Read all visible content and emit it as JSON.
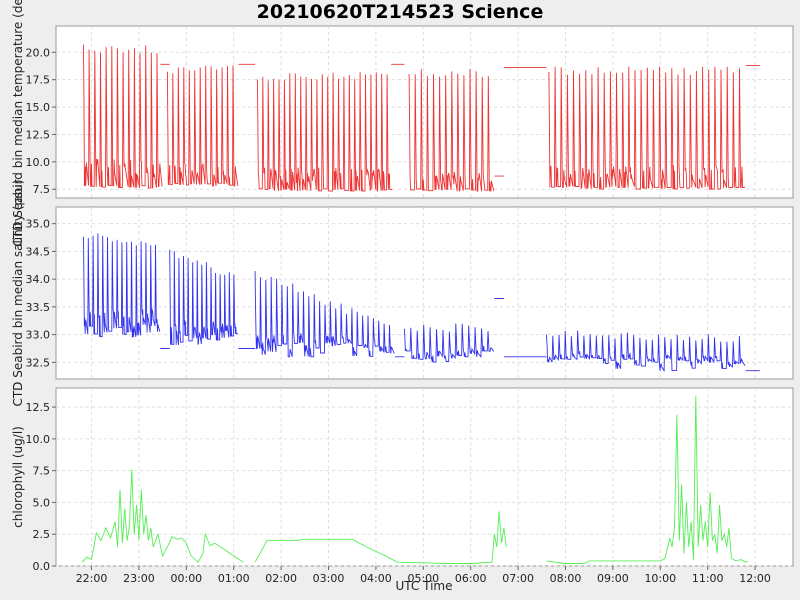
{
  "chart_data": {
    "title": "20210620T214523 Science",
    "xlabel": "UTC Time",
    "x_ticks": [
      "22:00",
      "23:00",
      "00:00",
      "01:00",
      "02:00",
      "03:00",
      "04:00",
      "05:00",
      "06:00",
      "07:00",
      "08:00",
      "09:00",
      "10:00",
      "11:00",
      "12:00"
    ],
    "x_range_hours": [
      21.25,
      24.8
    ],
    "grid": true,
    "panels": [
      {
        "type": "line",
        "ylabel": "CTD Seabird bin median temperature (degC)",
        "ylim": [
          6.7,
          22.4
        ],
        "y_ticks": [
          7.5,
          10.0,
          12.5,
          15.0,
          17.5,
          20.0
        ],
        "y_tick_labels": [
          "7.5",
          "10.0",
          "12.5",
          "15.0",
          "17.5",
          "20.0"
        ],
        "color": "#ee3333",
        "segments": [
          {
            "start": 21.83,
            "end": 23.5,
            "casts": 14,
            "high": 20.7,
            "low": 7.6,
            "mid": 9.5
          },
          {
            "start": 23.6,
            "end": 25.1,
            "casts": 13,
            "high": 18.8,
            "low": 7.8,
            "mid": 9.2
          },
          {
            "start": 25.5,
            "end": 28.35,
            "casts": 25,
            "high": 18.2,
            "low": 7.3,
            "mid": 8.8
          },
          {
            "start": 28.7,
            "end": 30.5,
            "casts": 14,
            "high": 18.5,
            "low": 7.3,
            "mid": 8.5
          },
          {
            "start": 31.65,
            "end": 35.8,
            "casts": 32,
            "high": 18.7,
            "low": 7.5,
            "mid": 9.0
          }
        ],
        "flats": [
          {
            "start": 23.45,
            "end": 23.65,
            "value": 18.9
          },
          {
            "start": 25.1,
            "end": 25.45,
            "value": 18.9
          },
          {
            "start": 28.32,
            "end": 28.6,
            "value": 18.9
          },
          {
            "start": 30.5,
            "end": 30.7,
            "value": 8.7
          },
          {
            "start": 30.7,
            "end": 31.6,
            "value": 18.6
          },
          {
            "start": 35.8,
            "end": 36.1,
            "value": 18.8
          }
        ]
      },
      {
        "type": "line",
        "ylabel": "CTD Seabird bin median salinity (psu)",
        "ylim": [
          32.2,
          35.3
        ],
        "y_ticks": [
          32.5,
          33.0,
          33.5,
          34.0,
          34.5,
          35.0
        ],
        "y_tick_labels": [
          "32.5",
          "33.0",
          "33.5",
          "34.0",
          "34.5",
          "35.0"
        ],
        "color": "#3333ee",
        "segments": [
          {
            "start": 21.83,
            "end": 23.45,
            "casts": 16,
            "high_start": 34.9,
            "high_end": 34.7,
            "low": 32.95
          },
          {
            "start": 23.65,
            "end": 25.1,
            "casts": 15,
            "high_start": 34.6,
            "high_end": 34.1,
            "low": 32.8
          },
          {
            "start": 25.45,
            "end": 28.4,
            "casts": 26,
            "high_start": 34.2,
            "high_end": 33.2,
            "low": 32.6
          },
          {
            "start": 28.6,
            "end": 30.5,
            "casts": 14,
            "high_start": 33.2,
            "high_end": 33.2,
            "low": 32.5
          },
          {
            "start": 31.6,
            "end": 35.8,
            "casts": 32,
            "high_start": 33.1,
            "high_end": 33.0,
            "low": 32.35
          }
        ],
        "flats": [
          {
            "start": 23.45,
            "end": 23.65,
            "value": 32.75
          },
          {
            "start": 25.1,
            "end": 25.45,
            "value": 32.75
          },
          {
            "start": 28.4,
            "end": 28.6,
            "value": 32.6
          },
          {
            "start": 30.5,
            "end": 30.7,
            "value": 33.65
          },
          {
            "start": 30.7,
            "end": 31.6,
            "value": 32.6
          },
          {
            "start": 35.8,
            "end": 36.1,
            "value": 32.35
          }
        ]
      },
      {
        "type": "line",
        "ylabel": "chlorophyll (ug/l)",
        "ylim": [
          0.0,
          14.0
        ],
        "y_ticks": [
          0.0,
          2.5,
          5.0,
          7.5,
          10.0,
          12.5
        ],
        "y_tick_labels": [
          "0.0",
          "2.5",
          "5.0",
          "7.5",
          "10.0",
          "12.5"
        ],
        "color": "#55ee55",
        "points": [
          [
            21.8,
            0.3
          ],
          [
            21.9,
            0.7
          ],
          [
            22.0,
            0.5
          ],
          [
            22.05,
            1.5
          ],
          [
            22.1,
            2.6
          ],
          [
            22.2,
            2.0
          ],
          [
            22.3,
            3.0
          ],
          [
            22.4,
            2.2
          ],
          [
            22.5,
            3.5
          ],
          [
            22.55,
            1.5
          ],
          [
            22.6,
            6.0
          ],
          [
            22.65,
            1.8
          ],
          [
            22.7,
            4.5
          ],
          [
            22.75,
            2.0
          ],
          [
            22.8,
            3.2
          ],
          [
            22.85,
            7.6
          ],
          [
            22.9,
            2.5
          ],
          [
            22.95,
            4.8
          ],
          [
            23.0,
            2.0
          ],
          [
            23.05,
            6.0
          ],
          [
            23.1,
            2.5
          ],
          [
            23.15,
            4.0
          ],
          [
            23.2,
            2.0
          ],
          [
            23.25,
            3.0
          ],
          [
            23.3,
            1.5
          ],
          [
            23.4,
            2.5
          ],
          [
            23.5,
            0.8
          ],
          [
            23.6,
            1.5
          ],
          [
            23.7,
            2.3
          ],
          [
            23.8,
            2.1
          ],
          [
            23.9,
            2.2
          ],
          [
            24.0,
            1.8
          ],
          [
            24.1,
            0.8
          ],
          [
            24.25,
            0.3
          ],
          [
            24.35,
            1.0
          ],
          [
            24.4,
            2.5
          ],
          [
            24.5,
            1.6
          ],
          [
            24.6,
            1.8
          ],
          [
            24.8,
            1.3
          ],
          [
            25.0,
            0.8
          ],
          [
            25.2,
            0.3
          ],
          null,
          [
            25.45,
            0.3
          ],
          [
            25.6,
            1.3
          ],
          [
            25.7,
            2.0
          ],
          [
            26.0,
            2.0
          ],
          [
            26.3,
            2.0
          ],
          [
            26.5,
            2.1
          ],
          [
            27.0,
            2.1
          ],
          [
            27.5,
            2.1
          ],
          [
            27.8,
            1.5
          ],
          [
            28.2,
            0.8
          ],
          [
            28.45,
            0.3
          ],
          [
            29.0,
            0.25
          ],
          [
            29.5,
            0.2
          ],
          [
            30.0,
            0.2
          ],
          [
            30.45,
            0.3
          ],
          [
            30.5,
            2.5
          ],
          [
            30.55,
            1.5
          ],
          [
            30.6,
            4.3
          ],
          [
            30.65,
            1.8
          ],
          [
            30.7,
            3.0
          ],
          [
            30.75,
            1.5
          ],
          null,
          [
            31.6,
            0.4
          ],
          [
            32.0,
            0.2
          ],
          [
            32.4,
            0.2
          ],
          [
            32.5,
            0.4
          ],
          [
            33.0,
            0.4
          ],
          [
            33.5,
            0.4
          ],
          [
            34.0,
            0.4
          ],
          [
            34.1,
            0.6
          ],
          [
            34.2,
            2.2
          ],
          [
            34.25,
            1.5
          ],
          [
            34.3,
            3.0
          ],
          [
            34.35,
            11.9
          ],
          [
            34.4,
            2.0
          ],
          [
            34.45,
            6.4
          ],
          [
            34.5,
            1.0
          ],
          [
            34.55,
            5.0
          ],
          [
            34.6,
            1.5
          ],
          [
            34.65,
            3.5
          ],
          [
            34.7,
            0.5
          ],
          [
            34.75,
            13.4
          ],
          [
            34.8,
            1.5
          ],
          [
            34.85,
            4.8
          ],
          [
            34.9,
            2.0
          ],
          [
            34.95,
            3.5
          ],
          [
            35.0,
            1.5
          ],
          [
            35.05,
            5.8
          ],
          [
            35.1,
            2.0
          ],
          [
            35.15,
            2.5
          ],
          [
            35.2,
            1.0
          ],
          [
            35.25,
            4.8
          ],
          [
            35.3,
            2.0
          ],
          [
            35.35,
            2.5
          ],
          [
            35.4,
            1.5
          ],
          [
            35.45,
            3.0
          ],
          [
            35.5,
            0.6
          ],
          [
            35.6,
            0.4
          ],
          [
            35.7,
            0.5
          ],
          [
            35.8,
            0.3
          ],
          [
            35.85,
            0.4
          ]
        ]
      }
    ]
  }
}
